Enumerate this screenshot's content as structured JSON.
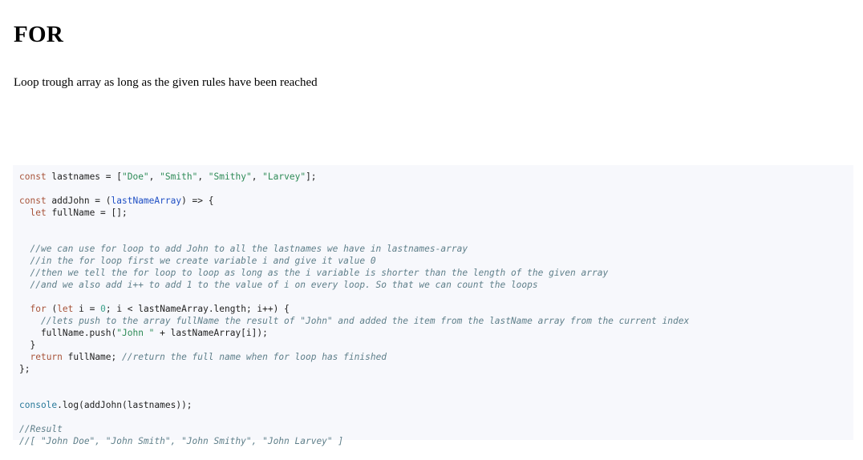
{
  "page": {
    "title": "FOR",
    "description": "Loop trough array as long as the given rules have been reached"
  },
  "code": {
    "lines": [
      [
        {
          "t": "kw",
          "v": "const"
        },
        {
          "t": "",
          "v": " lastnames = ["
        },
        {
          "t": "str",
          "v": "\"Doe\""
        },
        {
          "t": "",
          "v": ", "
        },
        {
          "t": "str",
          "v": "\"Smith\""
        },
        {
          "t": "",
          "v": ", "
        },
        {
          "t": "str",
          "v": "\"Smithy\""
        },
        {
          "t": "",
          "v": ", "
        },
        {
          "t": "str",
          "v": "\"Larvey\""
        },
        {
          "t": "",
          "v": "];"
        }
      ],
      [],
      [
        {
          "t": "kw",
          "v": "const"
        },
        {
          "t": "",
          "v": " addJohn = ("
        },
        {
          "t": "prm",
          "v": "lastNameArray"
        },
        {
          "t": "",
          "v": ") => {"
        }
      ],
      [
        {
          "t": "",
          "v": "  "
        },
        {
          "t": "kw",
          "v": "let"
        },
        {
          "t": "",
          "v": " fullName = [];"
        }
      ],
      [],
      [],
      [
        {
          "t": "",
          "v": "  "
        },
        {
          "t": "cm",
          "v": "//we can use for loop to add John to all the lastnames we have in lastnames-array"
        }
      ],
      [
        {
          "t": "",
          "v": "  "
        },
        {
          "t": "cm",
          "v": "//in the for loop first we create variable i and give it value 0"
        }
      ],
      [
        {
          "t": "",
          "v": "  "
        },
        {
          "t": "cm",
          "v": "//then we tell the for loop to loop as long as the i variable is shorter than the length of the given array"
        }
      ],
      [
        {
          "t": "",
          "v": "  "
        },
        {
          "t": "cm",
          "v": "//and we also add i++ to add 1 to the value of i on every loop. So that we can count the loops"
        }
      ],
      [],
      [
        {
          "t": "",
          "v": "  "
        },
        {
          "t": "kw",
          "v": "for"
        },
        {
          "t": "",
          "v": " ("
        },
        {
          "t": "kw",
          "v": "let"
        },
        {
          "t": "",
          "v": " i = "
        },
        {
          "t": "num",
          "v": "0"
        },
        {
          "t": "",
          "v": "; i < lastNameArray.length; i++) {"
        }
      ],
      [
        {
          "t": "",
          "v": "    "
        },
        {
          "t": "cm",
          "v": "//lets push to the array fullName the result of \"John\" and added the item from the lastName array from the current index"
        }
      ],
      [
        {
          "t": "",
          "v": "    fullName.push("
        },
        {
          "t": "str",
          "v": "\"John \""
        },
        {
          "t": "",
          "v": " + lastNameArray[i]);"
        }
      ],
      [
        {
          "t": "",
          "v": "  }"
        }
      ],
      [
        {
          "t": "",
          "v": "  "
        },
        {
          "t": "kw",
          "v": "return"
        },
        {
          "t": "",
          "v": " fullName; "
        },
        {
          "t": "cm",
          "v": "//return the full name when for loop has finished"
        }
      ],
      [
        {
          "t": "",
          "v": "};"
        }
      ],
      [],
      [],
      [
        {
          "t": "obj",
          "v": "console"
        },
        {
          "t": "",
          "v": ".log(addJohn(lastnames));"
        }
      ],
      [],
      [
        {
          "t": "cm",
          "v": "//Result"
        }
      ],
      [
        {
          "t": "cm",
          "v": "//[ \"John Doe\", \"John Smith\", \"John Smithy\", \"John Larvey\" ]"
        }
      ]
    ]
  }
}
